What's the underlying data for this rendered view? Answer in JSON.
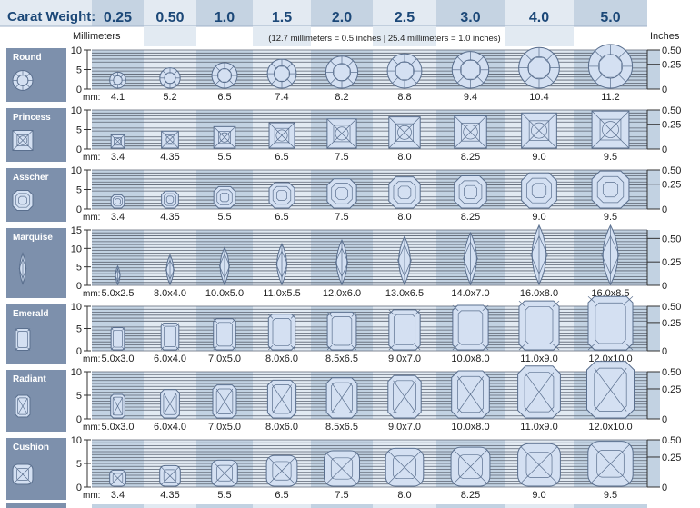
{
  "header": {
    "title": "Carat Weight:",
    "carats": [
      "0.25",
      "0.50",
      "1.0",
      "1.5",
      "2.0",
      "2.5",
      "3.0",
      "4.0",
      "5.0"
    ],
    "mm_label": "Millimeters",
    "inches_label": "Inches",
    "note": "(12.7 millimeters = 0.5 inches   |   25.4 millimeters = 1.0 inches)",
    "mm_prefix": "mm:"
  },
  "colors": {
    "header_dark": "#c5d3e2",
    "header_light": "#e3eaf2",
    "title": "#1c4878",
    "sidebar": "#7d90ac",
    "band_dark": "#c2d2e2",
    "band_light": "#e2eaf2",
    "line": "#5a6270",
    "gem_fill": "#d4e0f2",
    "gem_stroke": "#5a6f8e"
  },
  "rows": [
    {
      "name": "Round",
      "shape": "round",
      "ymax": 10,
      "yticks": [
        "10",
        "5",
        "0"
      ],
      "inch_ticks": [
        "0.50",
        "0.25",
        "0"
      ],
      "gems": [
        {
          "label": "4.1",
          "w": 4.1,
          "h": 4.1
        },
        {
          "label": "5.2",
          "w": 5.2,
          "h": 5.2
        },
        {
          "label": "6.5",
          "w": 6.5,
          "h": 6.5
        },
        {
          "label": "7.4",
          "w": 7.4,
          "h": 7.4
        },
        {
          "label": "8.2",
          "w": 8.2,
          "h": 8.2
        },
        {
          "label": "8.8",
          "w": 8.8,
          "h": 8.8
        },
        {
          "label": "9.4",
          "w": 9.4,
          "h": 9.4
        },
        {
          "label": "10.4",
          "w": 10.4,
          "h": 10.4
        },
        {
          "label": "11.2",
          "w": 11.2,
          "h": 11.2
        }
      ]
    },
    {
      "name": "Princess",
      "shape": "princess",
      "ymax": 10,
      "yticks": [
        "10",
        "5",
        "0"
      ],
      "inch_ticks": [
        "0.50",
        "0.25",
        "0"
      ],
      "gems": [
        {
          "label": "3.4",
          "w": 3.4,
          "h": 3.4
        },
        {
          "label": "4.35",
          "w": 4.35,
          "h": 4.35
        },
        {
          "label": "5.5",
          "w": 5.5,
          "h": 5.5
        },
        {
          "label": "6.5",
          "w": 6.5,
          "h": 6.5
        },
        {
          "label": "7.5",
          "w": 7.5,
          "h": 7.5
        },
        {
          "label": "8.0",
          "w": 8.0,
          "h": 8.0
        },
        {
          "label": "8.25",
          "w": 8.25,
          "h": 8.25
        },
        {
          "label": "9.0",
          "w": 9.0,
          "h": 9.0
        },
        {
          "label": "9.5",
          "w": 9.5,
          "h": 9.5
        }
      ]
    },
    {
      "name": "Asscher",
      "shape": "asscher",
      "ymax": 10,
      "yticks": [
        "10",
        "5",
        "0"
      ],
      "inch_ticks": [
        "0.50",
        "0.25",
        "0"
      ],
      "gems": [
        {
          "label": "3.4",
          "w": 3.4,
          "h": 3.4
        },
        {
          "label": "4.35",
          "w": 4.35,
          "h": 4.35
        },
        {
          "label": "5.5",
          "w": 5.5,
          "h": 5.5
        },
        {
          "label": "6.5",
          "w": 6.5,
          "h": 6.5
        },
        {
          "label": "7.5",
          "w": 7.5,
          "h": 7.5
        },
        {
          "label": "8.0",
          "w": 8.0,
          "h": 8.0
        },
        {
          "label": "8.25",
          "w": 8.25,
          "h": 8.25
        },
        {
          "label": "9.0",
          "w": 9.0,
          "h": 9.0
        },
        {
          "label": "9.5",
          "w": 9.5,
          "h": 9.5
        }
      ]
    },
    {
      "name": "Marquise",
      "shape": "marquise",
      "ymax": 15,
      "yticks": [
        "15",
        "10",
        "5",
        "0"
      ],
      "inch_ticks": [
        "0.50",
        "0.25",
        "0"
      ],
      "gems": [
        {
          "label": "5.0x2.5",
          "w": 2.5,
          "h": 5.0
        },
        {
          "label": "8.0x4.0",
          "w": 4.0,
          "h": 8.0
        },
        {
          "label": "10.0x5.0",
          "w": 5.0,
          "h": 10.0
        },
        {
          "label": "11.0x5.5",
          "w": 5.5,
          "h": 11.0
        },
        {
          "label": "12.0x6.0",
          "w": 6.0,
          "h": 12.0
        },
        {
          "label": "13.0x6.5",
          "w": 6.5,
          "h": 13.0
        },
        {
          "label": "14.0x7.0",
          "w": 7.0,
          "h": 14.0
        },
        {
          "label": "16.0x8.0",
          "w": 8.0,
          "h": 16.0
        },
        {
          "label": "16.0x8.5",
          "w": 8.5,
          "h": 16.0
        }
      ]
    },
    {
      "name": "Emerald",
      "shape": "emerald",
      "ymax": 10,
      "yticks": [
        "10",
        "5",
        "0"
      ],
      "inch_ticks": [
        "0.50",
        "0.25",
        "0"
      ],
      "gems": [
        {
          "label": "5.0x3.0",
          "w": 3.0,
          "h": 5.0
        },
        {
          "label": "6.0x4.0",
          "w": 4.0,
          "h": 6.0
        },
        {
          "label": "7.0x5.0",
          "w": 5.0,
          "h": 7.0
        },
        {
          "label": "8.0x6.0",
          "w": 6.0,
          "h": 8.0
        },
        {
          "label": "8.5x6.5",
          "w": 6.5,
          "h": 8.5
        },
        {
          "label": "9.0x7.0",
          "w": 7.0,
          "h": 9.0
        },
        {
          "label": "10.0x8.0",
          "w": 8.0,
          "h": 10.0
        },
        {
          "label": "11.0x9.0",
          "w": 9.0,
          "h": 11.0
        },
        {
          "label": "12.0x10.0",
          "w": 10.0,
          "h": 12.0
        }
      ]
    },
    {
      "name": "Radiant",
      "shape": "radiant",
      "ymax": 10,
      "yticks": [
        "10",
        "5",
        "0"
      ],
      "inch_ticks": [
        "0.50",
        "0.25",
        "0"
      ],
      "gems": [
        {
          "label": "5.0x3.0",
          "w": 3.0,
          "h": 5.0
        },
        {
          "label": "6.0x4.0",
          "w": 4.0,
          "h": 6.0
        },
        {
          "label": "7.0x5.0",
          "w": 5.0,
          "h": 7.0
        },
        {
          "label": "8.0x6.0",
          "w": 6.0,
          "h": 8.0
        },
        {
          "label": "8.5x6.5",
          "w": 6.5,
          "h": 8.5
        },
        {
          "label": "9.0x7.0",
          "w": 7.0,
          "h": 9.0
        },
        {
          "label": "10.0x8.0",
          "w": 8.0,
          "h": 10.0
        },
        {
          "label": "11.0x9.0",
          "w": 9.0,
          "h": 11.0
        },
        {
          "label": "12.0x10.0",
          "w": 10.0,
          "h": 12.0
        }
      ]
    },
    {
      "name": "Cushion",
      "shape": "cushion",
      "ymax": 10,
      "yticks": [
        "10",
        "5",
        "0"
      ],
      "inch_ticks": [
        "0.50",
        "0.25",
        "0"
      ],
      "gems": [
        {
          "label": "3.4",
          "w": 3.4,
          "h": 3.4
        },
        {
          "label": "4.35",
          "w": 4.35,
          "h": 4.35
        },
        {
          "label": "5.5",
          "w": 5.5,
          "h": 5.5
        },
        {
          "label": "6.5",
          "w": 6.5,
          "h": 6.5
        },
        {
          "label": "7.5",
          "w": 7.5,
          "h": 7.5
        },
        {
          "label": "8.0",
          "w": 8.0,
          "h": 8.0
        },
        {
          "label": "8.25",
          "w": 8.25,
          "h": 8.25
        },
        {
          "label": "9.0",
          "w": 9.0,
          "h": 9.0
        },
        {
          "label": "9.5",
          "w": 9.5,
          "h": 9.5
        }
      ]
    }
  ]
}
